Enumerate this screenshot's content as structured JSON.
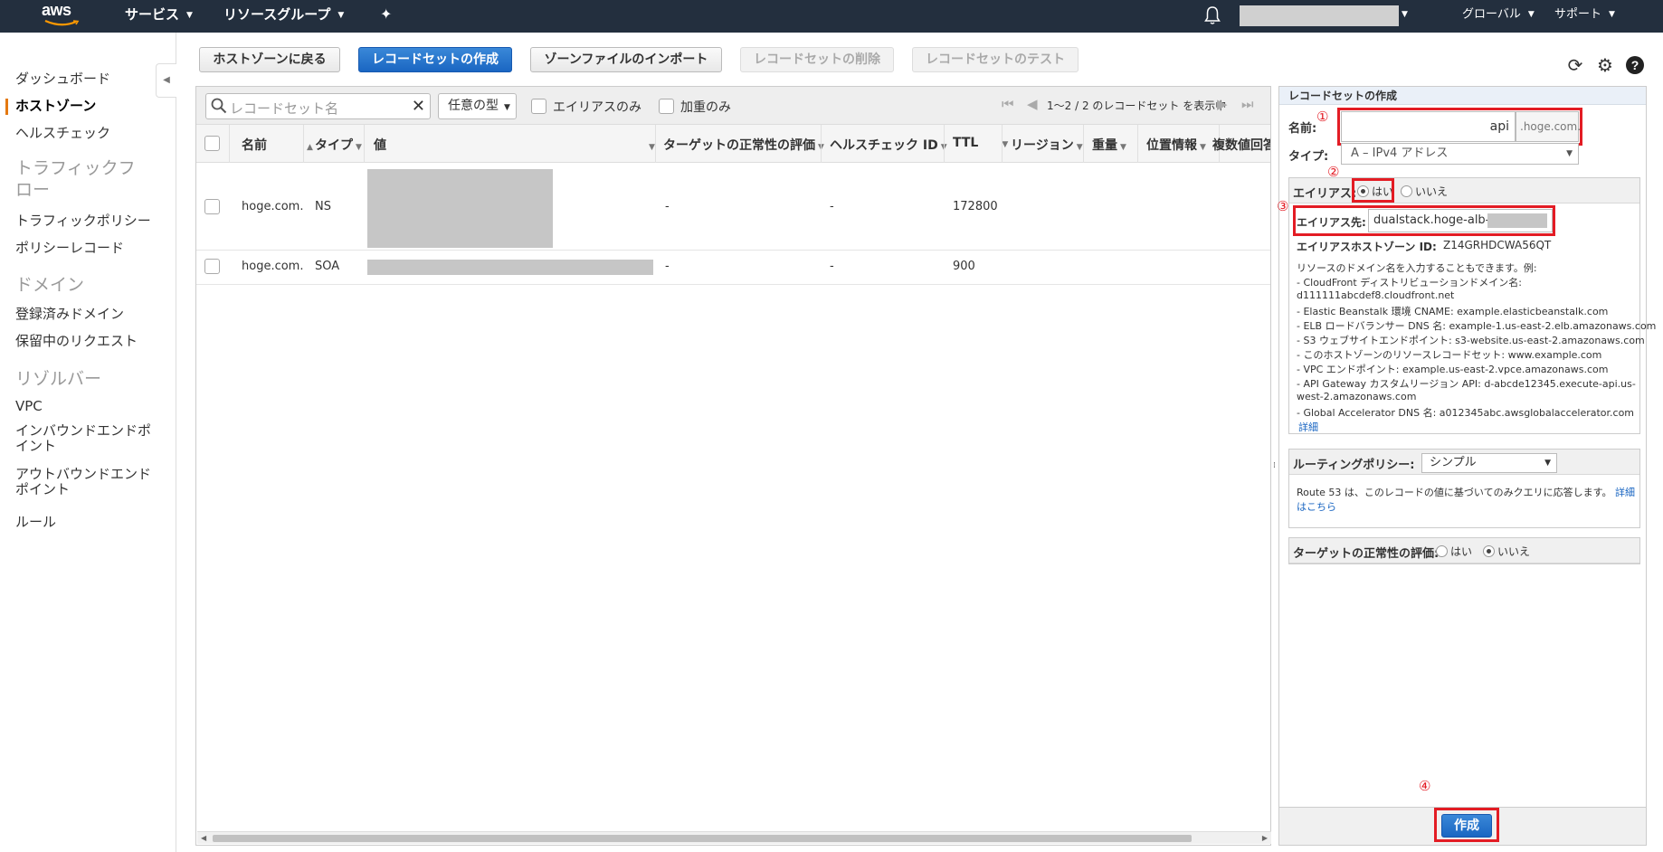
{
  "topnav": {
    "logo_text": "aws",
    "services": "サービス",
    "resource_groups": "リソースグループ",
    "global": "グローバル",
    "support": "サポート"
  },
  "sidebar": {
    "items": [
      {
        "label": "ダッシュボード"
      },
      {
        "label": "ホストゾーン"
      },
      {
        "label": "ヘルスチェック"
      }
    ],
    "traffic_flow_title": "トラフィックフロー",
    "traffic_flow_items": [
      {
        "label": "トラフィックポリシー"
      },
      {
        "label": "ポリシーレコード"
      }
    ],
    "domain_title": "ドメイン",
    "domain_items": [
      {
        "label": "登録済みドメイン"
      },
      {
        "label": "保留中のリクエスト"
      }
    ],
    "resolver_title": "リゾルバー",
    "resolver_items": [
      {
        "label": "VPC"
      },
      {
        "label": "インバウンドエンドポイント"
      },
      {
        "label": "アウトバウンドエンドポイント"
      },
      {
        "label": "ルール"
      }
    ]
  },
  "toolbar": {
    "back": "ホストゾーンに戻る",
    "create": "レコードセットの作成",
    "import": "ゾーンファイルのインポート",
    "delete": "レコードセットの削除",
    "test": "レコードセットのテスト"
  },
  "filter": {
    "search_placeholder": "レコードセット名",
    "type_select": "任意の型",
    "alias_only": "エイリアスのみ",
    "weighted_only": "加重のみ",
    "pager_text": "1～2 / 2 のレコードセット を表示中"
  },
  "columns": {
    "name": "名前",
    "type": "タイプ",
    "value": "値",
    "target_health": "ターゲットの正常性の評価",
    "health_check": "ヘルスチェック ID",
    "ttl": "TTL",
    "region": "リージョン",
    "weight": "重量",
    "geo": "位置情報",
    "multi": "複数値回答"
  },
  "rows": [
    {
      "name": "hoge.com.",
      "type": "NS",
      "target_health": "-",
      "health_check": "-",
      "ttl": "172800"
    },
    {
      "name": "hoge.com.",
      "type": "SOA",
      "target_health": "-",
      "health_check": "-",
      "ttl": "900"
    }
  ],
  "panel": {
    "header": "レコードセットの作成",
    "name_label": "名前:",
    "name_value": "api",
    "name_suffix": ".hoge.com.",
    "type_label": "タイプ:",
    "type_value": "A – IPv4 アドレス",
    "alias_label": "エイリアス:",
    "alias_yes": "はい",
    "alias_no": "いいえ",
    "alias_target_label": "エイリアス先:",
    "alias_target_value": "dualstack.hoge-alb-",
    "alias_zone_label": "エイリアスホストゾーン ID:",
    "alias_zone_value": "Z14GRHDCWA56QT",
    "help_lines": [
      "リソースのドメイン名を入力することもできます。例:",
      "- CloudFront ディストリビューションドメイン名:",
      "d111111abcdef8.cloudfront.net",
      "- Elastic Beanstalk 環境 CNAME: example.elasticbeanstalk.com",
      "- ELB ロードバランサー DNS 名: example-1.us-east-2.elb.amazonaws.com",
      "- S3 ウェブサイトエンドポイント: s3-website.us-east-2.amazonaws.com",
      "- このホストゾーンのリソースレコードセット: www.example.com",
      "- VPC エンドポイント: example.us-east-2.vpce.amazonaws.com",
      "- API Gateway カスタムリージョン API: d-abcde12345.execute-api.us-",
      "west-2.amazonaws.com",
      "- Global Accelerator DNS 名: a012345abc.awsglobalaccelerator.com"
    ],
    "details_link": "詳細",
    "routing_label": "ルーティングポリシー:",
    "routing_value": "シンプル",
    "routing_help": "Route 53 は、このレコードの値に基づいてのみクエリに応答します。",
    "routing_link1": "詳細",
    "routing_link2": "はこちら",
    "health_label": "ターゲットの正常性の評価:",
    "health_yes": "はい",
    "health_no": "いいえ",
    "create_button": "作成",
    "markers": [
      "①",
      "②",
      "③",
      "④"
    ]
  },
  "colors": {
    "nav_bg": "#232f3e",
    "primary": "#1a66c2",
    "highlight": "#e31c24",
    "active_accent": "#e47911"
  }
}
